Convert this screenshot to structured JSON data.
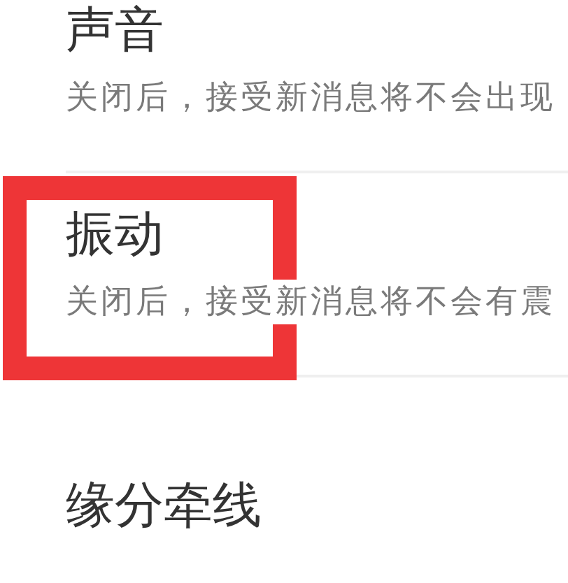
{
  "settings": [
    {
      "title": "声音",
      "description": "关闭后，接受新消息将不会出现",
      "highlighted": false
    },
    {
      "title": "振动",
      "description": "关闭后，接受新消息将不会有震",
      "highlighted": true
    },
    {
      "title": "缘分牵线",
      "highlighted": false
    }
  ]
}
